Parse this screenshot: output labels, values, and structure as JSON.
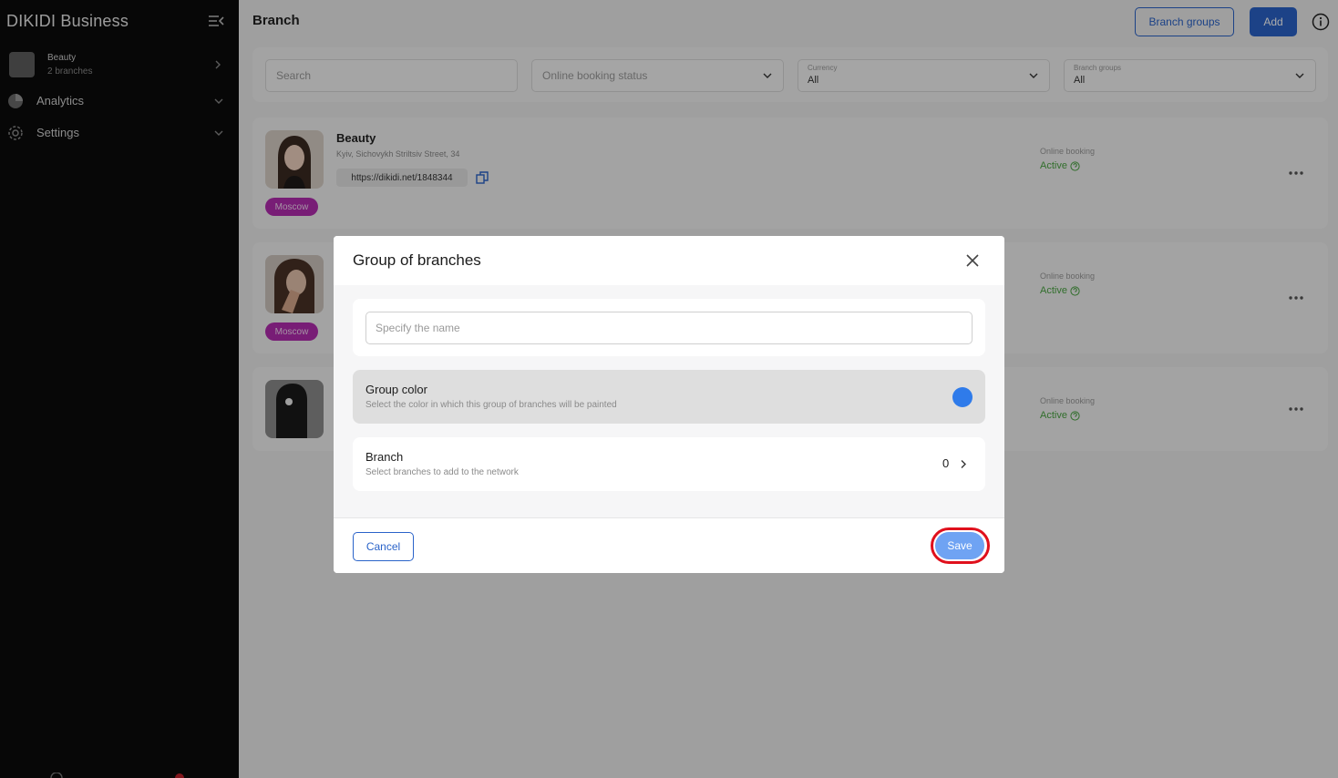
{
  "sidebar": {
    "brand": "DIKIDI Business",
    "account": {
      "name": "Beauty",
      "sub": "2 branches"
    },
    "nav": [
      {
        "label": "Analytics",
        "icon": "pie-chart-icon"
      },
      {
        "label": "Settings",
        "icon": "gear-icon"
      }
    ]
  },
  "header": {
    "title": "Branch",
    "branch_groups_label": "Branch groups",
    "add_label": "Add"
  },
  "filters": {
    "search_placeholder": "Search",
    "online_booking_placeholder": "Online booking status",
    "currency": {
      "label": "Currency",
      "value": "All"
    },
    "branch_groups": {
      "label": "Branch groups",
      "value": "All"
    }
  },
  "branches": [
    {
      "name": "Beauty",
      "address": "Kyiv, Sichovykh Striltsiv Street, 34",
      "link": "https://dikidi.net/1848344",
      "tag": "Moscow",
      "ob_label": "Online booking",
      "ob_status": "Active"
    },
    {
      "tag": "Moscow",
      "ob_label": "Online booking",
      "ob_status": "Active"
    },
    {
      "ob_label": "Online booking",
      "ob_status": "Active"
    }
  ],
  "modal": {
    "title": "Group of branches",
    "name_placeholder": "Specify the name",
    "group_color": {
      "title": "Group color",
      "subtitle": "Select the color in which this group of branches will be painted",
      "color": "#2f7bea"
    },
    "branch": {
      "title": "Branch",
      "subtitle": "Select branches to add to the network",
      "count": "0"
    },
    "cancel_label": "Cancel",
    "save_label": "Save"
  },
  "colors": {
    "accent": "#2a63c9",
    "tag": "#b42cb0",
    "active": "#4aa542",
    "highlight": "#e0101c"
  }
}
